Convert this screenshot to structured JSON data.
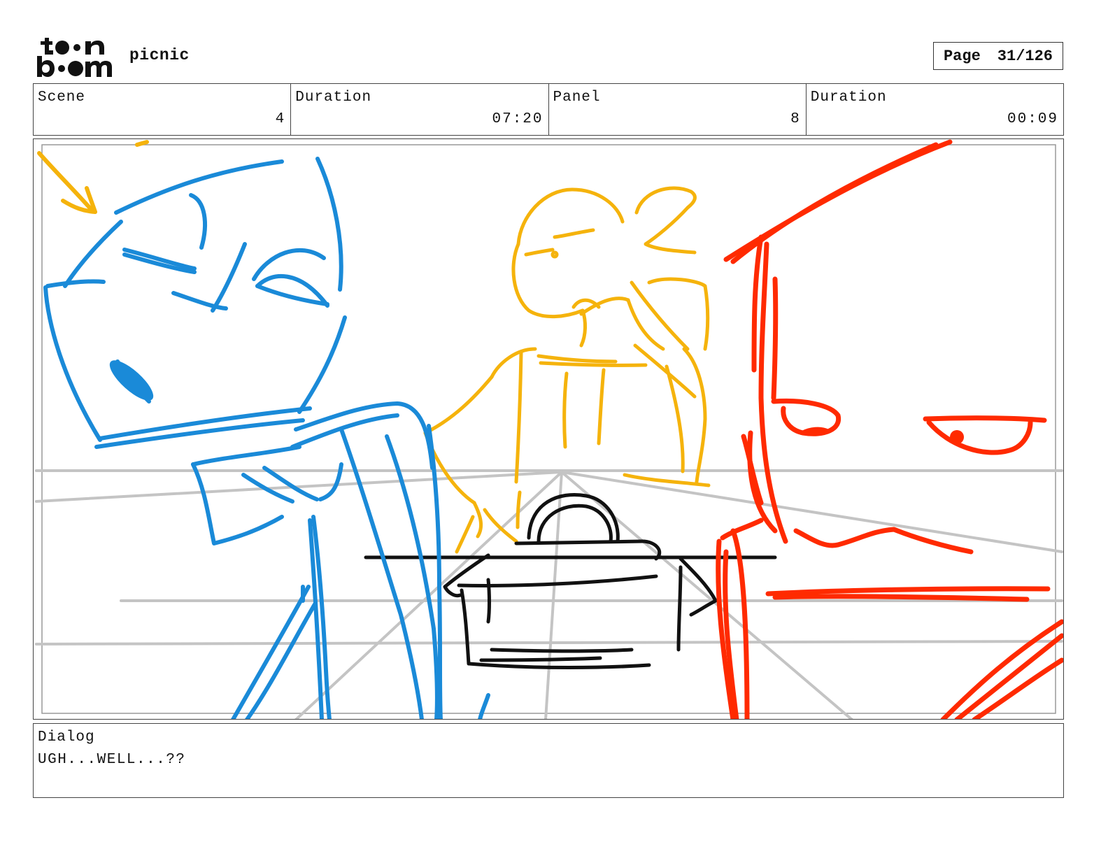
{
  "header": {
    "logo_text": "toon boom",
    "project_title": "picnic",
    "page_label": "Page",
    "page_value": "31/126"
  },
  "info": {
    "scene_label": "Scene",
    "scene_value": "4",
    "scene_duration_label": "Duration",
    "scene_duration_value": "07:20",
    "panel_label": "Panel",
    "panel_value": "8",
    "panel_duration_label": "Duration",
    "panel_duration_value": "00:09"
  },
  "dialog": {
    "label": "Dialog",
    "text": "UGH...WELL...??"
  },
  "colors": {
    "blue_character": "#1a8ad8",
    "yellow_character": "#f5b30c",
    "red_character": "#ff2a00",
    "basket": "#111111",
    "guides": "#c4c4c4"
  }
}
